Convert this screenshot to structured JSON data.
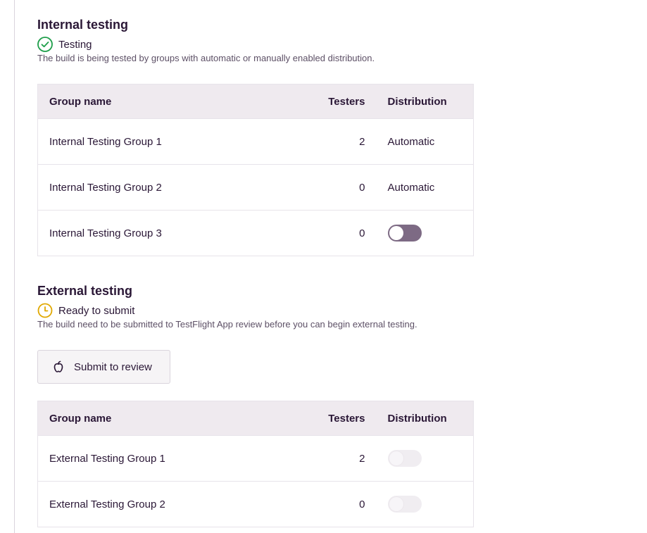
{
  "internal": {
    "title": "Internal testing",
    "status": "Testing",
    "description": "The build is being tested by groups with automatic or manually enabled distribution.",
    "columns": {
      "name": "Group name",
      "testers": "Testers",
      "distribution": "Distribution"
    },
    "rows": [
      {
        "name": "Internal Testing Group 1",
        "testers": "2",
        "distribution": "Automatic"
      },
      {
        "name": "Internal Testing Group 2",
        "testers": "0",
        "distribution": "Automatic"
      },
      {
        "name": "Internal Testing Group 3",
        "testers": "0",
        "distribution": ""
      }
    ]
  },
  "external": {
    "title": "External testing",
    "status": "Ready to submit",
    "description": "The build need to be submitted to TestFlight App review before you can begin external testing.",
    "submit_label": "Submit to review",
    "columns": {
      "name": "Group name",
      "testers": "Testers",
      "distribution": "Distribution"
    },
    "rows": [
      {
        "name": "External Testing Group 1",
        "testers": "2"
      },
      {
        "name": "External Testing Group 2",
        "testers": "0"
      }
    ]
  },
  "icons": {
    "testing_status": "check-circle-icon",
    "ready_status": "clock-icon",
    "submit": "apple-icon"
  },
  "colors": {
    "success": "#1e9e4a",
    "pending": "#e0a800",
    "toggle_off": "#7d6a84"
  }
}
